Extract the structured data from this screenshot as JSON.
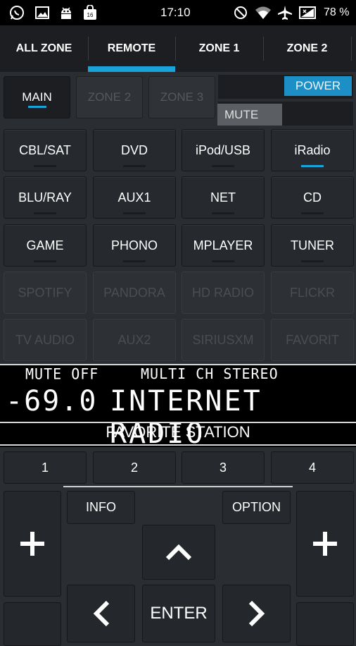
{
  "status_bar": {
    "time": "17:10",
    "battery": "78 %",
    "left_icons": [
      "whatsapp-icon",
      "image-icon",
      "android-icon",
      "bag-icon"
    ],
    "right_icons": [
      "do-not-disturb-icon",
      "wifi-icon",
      "airplane-icon",
      "signal-icon"
    ],
    "bag_badge": "16"
  },
  "tabs": [
    "ALL ZONE",
    "REMOTE",
    "ZONE 1",
    "ZONE 2"
  ],
  "active_tab": "REMOTE",
  "zones": [
    "MAIN",
    "ZONE 2",
    "ZONE 3"
  ],
  "power_label": "POWER",
  "mute_label": "MUTE",
  "sources": {
    "row1": [
      "CBL/SAT",
      "DVD",
      "iPod/USB",
      "iRadio"
    ],
    "row2": [
      "BLU/RAY",
      "AUX1",
      "NET",
      "CD"
    ],
    "row3": [
      "GAME",
      "PHONO",
      "MPLAYER",
      "TUNER"
    ],
    "row4": [
      "SPOTIFY",
      "PANDORA",
      "HD RADIO",
      "FLICKR"
    ],
    "row5": [
      "TV AUDIO",
      "AUX2",
      "SIRIUSXM",
      "FAVORIT"
    ],
    "selected": "iRadio"
  },
  "display": {
    "mute_status": "MUTE OFF",
    "mode": "MULTI CH STEREO",
    "volume": "-69.0",
    "source": "INTERNET RADIO",
    "favorite_label": "FAVORITE STATION"
  },
  "favorites": [
    "1",
    "2",
    "3",
    "4"
  ],
  "controls": {
    "info": "INFO",
    "option": "OPTION",
    "enter": "ENTER",
    "plus": "+",
    "up": "^",
    "left": "<",
    "right": ">"
  },
  "colors": {
    "accent": "#1aa3d8",
    "power": "#1b8fc6"
  }
}
